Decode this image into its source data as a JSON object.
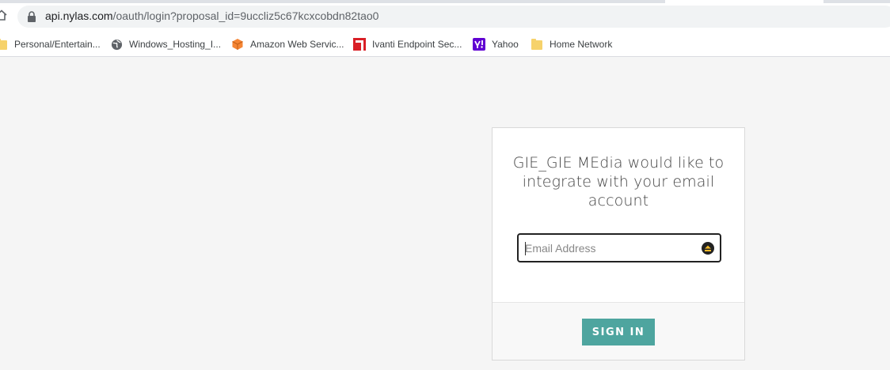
{
  "browser": {
    "url_host": "api.nylas.com",
    "url_path": "/oauth/login?proposal_id=9uccliz5c67kcxcobdn82tao0"
  },
  "bookmarks": [
    {
      "label": "Personal/Entertain...",
      "icon": "folder-icon"
    },
    {
      "label": "Windows_Hosting_I...",
      "icon": "globe-icon"
    },
    {
      "label": "Amazon Web Servic...",
      "icon": "aws-cube-icon"
    },
    {
      "label": "Ivanti Endpoint Sec...",
      "icon": "ivanti-logo-icon"
    },
    {
      "label": "Yahoo",
      "icon": "yahoo-logo-icon"
    },
    {
      "label": "Home Network",
      "icon": "folder-icon"
    }
  ],
  "login": {
    "title": "GIE_GIE MEdia would like to integrate with your email account",
    "email_placeholder": "Email Address",
    "email_value": "",
    "signin_label": "SIGN IN"
  },
  "colors": {
    "accent": "#4ea59f",
    "page_bg": "#f5f5f5"
  }
}
